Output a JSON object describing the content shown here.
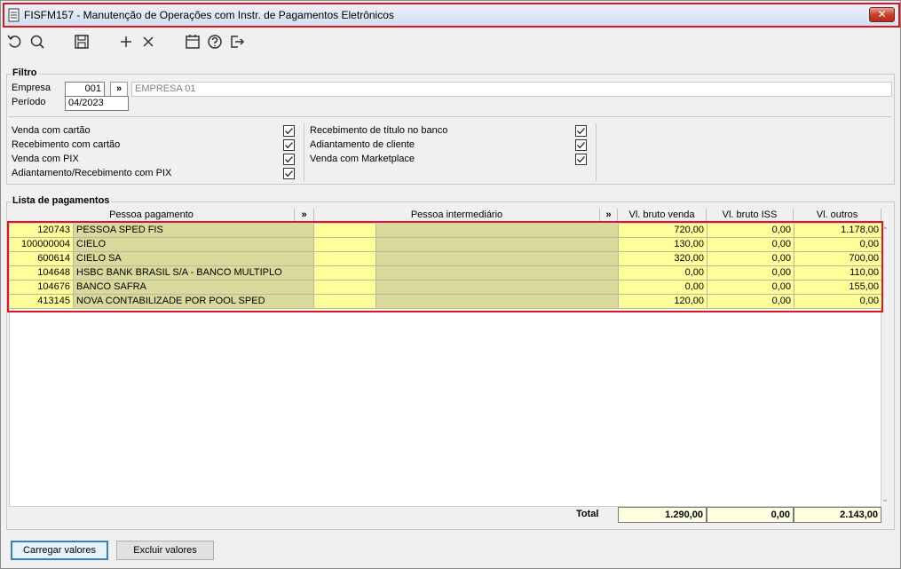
{
  "window": {
    "title": "FISFM157 - Manutenção de Operações com Instr. de Pagamentos Eletrônicos",
    "close_label": "✕"
  },
  "toolbar": {
    "icons": [
      "undo-icon",
      "search-icon",
      "save-icon",
      "add-icon",
      "delete-icon",
      "calendar-icon",
      "help-icon",
      "exit-icon"
    ]
  },
  "filtro": {
    "label": "Filtro",
    "empresa_label": "Empresa",
    "empresa_code": "001",
    "lookup_label": "»",
    "empresa_name": "EMPRESA 01",
    "periodo_label": "Período",
    "periodo_value": "04/2023",
    "checks_left": [
      {
        "label": "Venda com cartão",
        "checked": true
      },
      {
        "label": "Recebimento com cartão",
        "checked": true
      },
      {
        "label": "Venda com PIX",
        "checked": true
      },
      {
        "label": "Adiantamento/Recebimento com PIX",
        "checked": true
      }
    ],
    "checks_right": [
      {
        "label": "Recebimento de título no banco",
        "checked": true
      },
      {
        "label": "Adiantamento de cliente",
        "checked": true
      },
      {
        "label": "Venda com Marketplace",
        "checked": true
      }
    ]
  },
  "lista": {
    "label": "Lista de pagamentos",
    "columns": {
      "pessoa_pagamento": "Pessoa pagamento",
      "arrow": "»",
      "pessoa_intermediario": "Pessoa intermediário",
      "vl_bruto_venda": "Vl. bruto venda",
      "vl_bruto_iss": "Vl. bruto ISS",
      "vl_outros": "Vl. outros"
    },
    "rows": [
      {
        "code": "120743",
        "name": "PESSOA SPED FIS",
        "venda": "720,00",
        "iss": "0,00",
        "outros": "1.178,00"
      },
      {
        "code": "100000004",
        "name": "CIELO",
        "venda": "130,00",
        "iss": "0,00",
        "outros": "0,00"
      },
      {
        "code": "600614",
        "name": "CIELO SA",
        "venda": "320,00",
        "iss": "0,00",
        "outros": "700,00"
      },
      {
        "code": "104648",
        "name": "HSBC BANK BRASIL S/A - BANCO MULTIPLO",
        "venda": "0,00",
        "iss": "0,00",
        "outros": "110,00"
      },
      {
        "code": "104676",
        "name": "BANCO SAFRA",
        "venda": "0,00",
        "iss": "0,00",
        "outros": "155,00"
      },
      {
        "code": "413145",
        "name": "NOVA CONTABILIZADE POR POOL SPED",
        "venda": "120,00",
        "iss": "0,00",
        "outros": "0,00"
      }
    ],
    "total_label": "Total",
    "total_venda": "1.290,00",
    "total_iss": "0,00",
    "total_outros": "2.143,00"
  },
  "buttons": {
    "carregar": "Carregar valores",
    "excluir": "Excluir valores"
  },
  "colors": {
    "highlight": "#e0161f",
    "row_yellow": "#ffff99",
    "row_olive": "#d9d99b"
  }
}
